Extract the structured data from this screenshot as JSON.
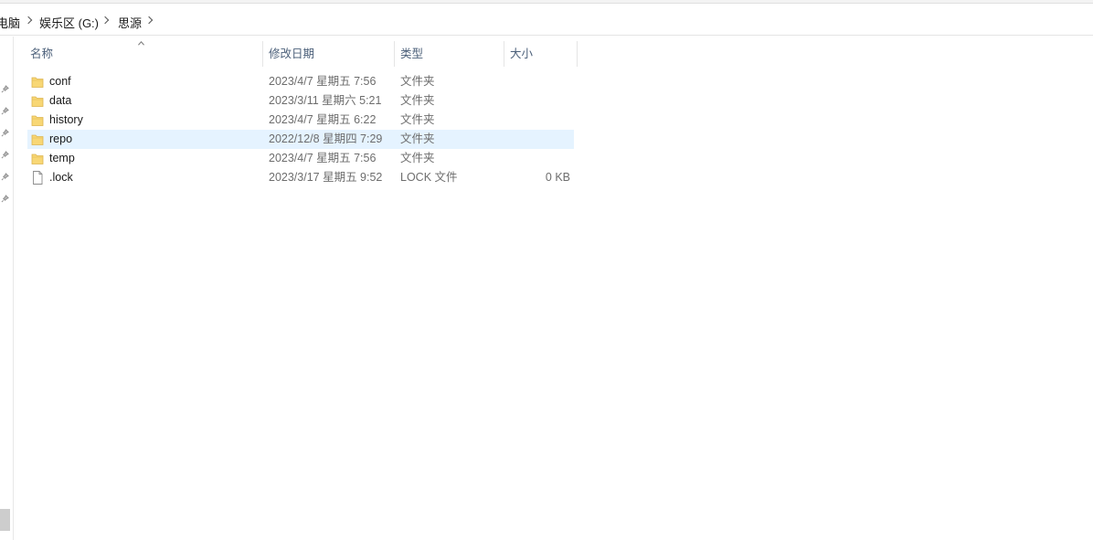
{
  "breadcrumb": {
    "items": [
      "电脑",
      "娱乐区 (G:)",
      "思源"
    ]
  },
  "columns": {
    "name": "名称",
    "date": "修改日期",
    "type": "类型",
    "size": "大小"
  },
  "files": [
    {
      "name": "conf",
      "date": "2023/4/7 星期五 7:56",
      "type": "文件夹",
      "size": "",
      "icon": "folder-icon"
    },
    {
      "name": "data",
      "date": "2023/3/11 星期六 5:21",
      "type": "文件夹",
      "size": "",
      "icon": "folder-icon"
    },
    {
      "name": "history",
      "date": "2023/4/7 星期五 6:22",
      "type": "文件夹",
      "size": "",
      "icon": "folder-icon"
    },
    {
      "name": "repo",
      "date": "2022/12/8 星期四 7:29",
      "type": "文件夹",
      "size": "",
      "icon": "folder-icon",
      "selected": true
    },
    {
      "name": "temp",
      "date": "2023/4/7 星期五 7:56",
      "type": "文件夹",
      "size": "",
      "icon": "folder-icon"
    },
    {
      "name": ".lock",
      "date": "2023/3/17 星期五 9:52",
      "type": "LOCK 文件",
      "size": "0 KB",
      "icon": "file-icon"
    }
  ],
  "colors": {
    "folder": "#f8d775",
    "selection": "#e5f3ff",
    "header_text": "#4c607a"
  }
}
